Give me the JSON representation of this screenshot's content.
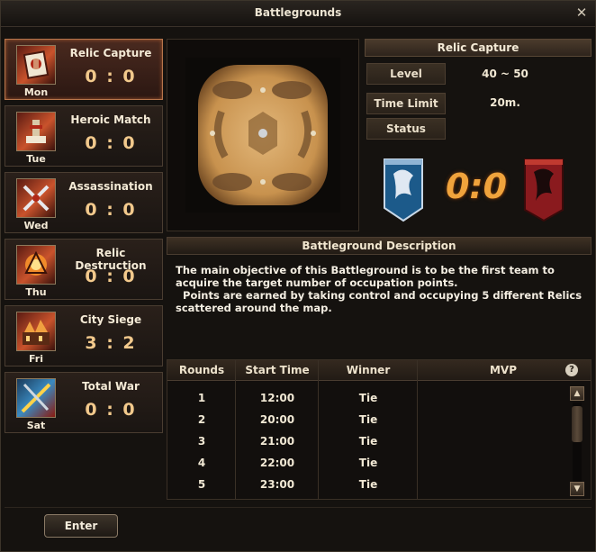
{
  "window": {
    "title": "Battlegrounds"
  },
  "days": [
    {
      "title": "Relic Capture",
      "score": "0 : 0",
      "day": "Mon",
      "icon": "relic-capture-icon",
      "selected": true
    },
    {
      "title": "Heroic Match",
      "score": "0 : 0",
      "day": "Tue",
      "icon": "heroic-match-icon",
      "selected": false
    },
    {
      "title": "Assassination",
      "score": "0 : 0",
      "day": "Wed",
      "icon": "assassination-icon",
      "selected": false
    },
    {
      "title": "Relic Destruction",
      "score": "0 : 0",
      "day": "Thu",
      "icon": "relic-destruction-icon",
      "selected": false
    },
    {
      "title": "City Siege",
      "score": "3 : 2",
      "day": "Fri",
      "icon": "city-siege-icon",
      "selected": false
    },
    {
      "title": "Total War",
      "score": "0 : 0",
      "day": "Sat",
      "icon": "total-war-icon",
      "selected": false
    }
  ],
  "detail": {
    "title": "Relic Capture",
    "level_label": "Level",
    "level_value": "40 ~ 50",
    "time_limit_label": "Time Limit",
    "time_limit_value": "20m.",
    "status_label": "Status",
    "status_value": "",
    "score": "0:0",
    "team_left_icon": "blue-dragon-banner-icon",
    "team_right_icon": "red-dragon-banner-icon"
  },
  "description": {
    "header": "Battleground Description",
    "text": "The main objective of this Battleground is to be the first team to\nacquire the target number of occupation points.\n  Points are earned by taking control and occupying 5 different Relics\nscattered around the map."
  },
  "table": {
    "headers": [
      "Rounds",
      "Start Time",
      "Winner",
      "MVP"
    ],
    "rows": [
      {
        "round": "1",
        "start": "12:00",
        "winner": "Tie",
        "mvp": ""
      },
      {
        "round": "2",
        "start": "20:00",
        "winner": "Tie",
        "mvp": ""
      },
      {
        "round": "3",
        "start": "21:00",
        "winner": "Tie",
        "mvp": ""
      },
      {
        "round": "4",
        "start": "22:00",
        "winner": "Tie",
        "mvp": ""
      },
      {
        "round": "5",
        "start": "23:00",
        "winner": "Tie",
        "mvp": ""
      }
    ],
    "help_symbol": "?"
  },
  "actions": {
    "enter_label": "Enter"
  },
  "colors": {
    "accent": "#f0a33c",
    "selected_border": "#b8764c",
    "panel_bg": "#15120f"
  }
}
